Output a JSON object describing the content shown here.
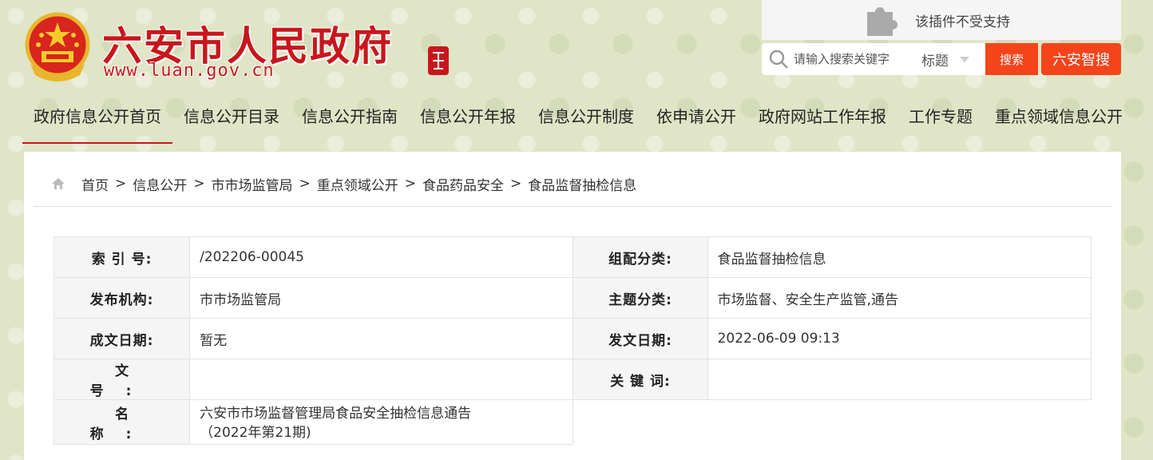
{
  "header": {
    "site_title": "六安市人民政府",
    "site_url": "www.luan.gov.cn",
    "plugin_message": "该插件不受支持",
    "search": {
      "placeholder": "请输入搜索关键字",
      "type_label": "标题",
      "button_label": "搜索",
      "smart_search_label": "六安智搜"
    }
  },
  "nav": {
    "items": [
      {
        "label": "政府信息公开首页",
        "active": true
      },
      {
        "label": "信息公开目录"
      },
      {
        "label": "信息公开指南"
      },
      {
        "label": "信息公开年报"
      },
      {
        "label": "信息公开制度"
      },
      {
        "label": "依申请公开"
      },
      {
        "label": "政府网站工作年报"
      },
      {
        "label": "工作专题"
      },
      {
        "label": "重点领域信息公开"
      }
    ]
  },
  "breadcrumb": {
    "separator": ">",
    "items": [
      "首页",
      "信息公开",
      "市市场监管局",
      "重点领域公开",
      "食品药品安全",
      "食品监督抽检信息"
    ]
  },
  "info": {
    "index_label": "索 引 号:",
    "index_value": "/202206-00045",
    "category_label": "组配分类:",
    "category_value": "食品监督抽检信息",
    "publisher_label": "发布机构:",
    "publisher_value": "市市场监管局",
    "topic_label": "主题分类:",
    "topic_value": "市场监督、安全生产监管,通告",
    "created_label": "成文日期:",
    "created_value": "暂无",
    "issued_label": "发文日期:",
    "issued_value": "2022-06-09 09:13",
    "docno_label": "文 号:",
    "docno_value": "",
    "keywords_label": "关 键 词:",
    "keywords_value": "",
    "name_label": "名 称:",
    "name_value_line1": "六安市市场监督管理局食品安全抽检信息通告",
    "name_value_line2": "（2022年第21期)"
  },
  "colors": {
    "brand_red": "#c8161d",
    "accent_orange": "#f5441b",
    "background": "#dfe5c6"
  }
}
